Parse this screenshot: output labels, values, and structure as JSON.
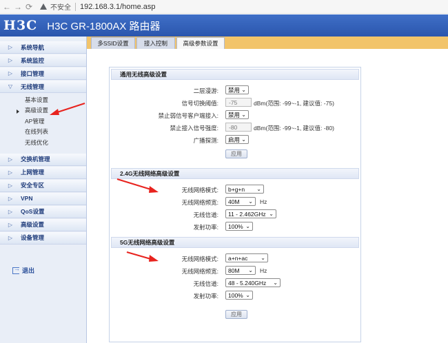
{
  "browser": {
    "insecure_label": "不安全",
    "url": "192.168.3.1/home.asp"
  },
  "header": {
    "logo": "H3C",
    "title": "H3C GR-1800AX 路由器"
  },
  "sidebar": {
    "items": [
      {
        "label": "系统导航",
        "arrow": "▷"
      },
      {
        "label": "系统监控",
        "arrow": "▷"
      },
      {
        "label": "接口管理",
        "arrow": "▷"
      },
      {
        "label": "无线管理",
        "arrow": "▽"
      }
    ],
    "sub_items": [
      {
        "label": "基本设置"
      },
      {
        "label": "高级设置"
      },
      {
        "label": "AP管理"
      },
      {
        "label": "在线列表"
      },
      {
        "label": "无线优化"
      }
    ],
    "items_after": [
      {
        "label": "交换机管理",
        "arrow": "▷"
      },
      {
        "label": "上网管理",
        "arrow": "▷"
      },
      {
        "label": "安全专区",
        "arrow": "▷"
      },
      {
        "label": "VPN",
        "arrow": "▷"
      },
      {
        "label": "QoS设置",
        "arrow": "▷"
      },
      {
        "label": "高级设置",
        "arrow": "▷"
      },
      {
        "label": "设备管理",
        "arrow": "▷"
      }
    ],
    "logout": "退出"
  },
  "tabs": [
    {
      "label": "多SSID设置"
    },
    {
      "label": "接入控制"
    },
    {
      "label": "高级参数设置"
    }
  ],
  "general": {
    "heading": "通用无线高级设置",
    "rows": [
      {
        "label": "二层漫游:",
        "value": "禁用"
      },
      {
        "label": "信号切换阈值:",
        "value": "-75",
        "hint": "dBm(范围: -99~-1, 建议值: -75)"
      },
      {
        "label": "禁止弱信号客户端接入:",
        "value": "禁用"
      },
      {
        "label": "禁止接入信号强度:",
        "value": "-80",
        "hint": "dBm(范围: -99~-1, 建议值: -80)"
      },
      {
        "label": "广播探测:",
        "value": "启用"
      }
    ],
    "apply": "应用"
  },
  "band24": {
    "heading": "2.4G无线网络高级设置",
    "rows": [
      {
        "label": "无线网络模式:",
        "value": "b+g+n"
      },
      {
        "label": "无线网络频宽:",
        "value": "40M",
        "unit": "Hz"
      },
      {
        "label": "无线信道:",
        "value": "11 - 2.462GHz"
      },
      {
        "label": "发射功率:",
        "value": "100%"
      }
    ]
  },
  "band5": {
    "heading": "5G无线网络高级设置",
    "rows": [
      {
        "label": "无线网络模式:",
        "value": "a+n+ac"
      },
      {
        "label": "无线网络频宽:",
        "value": "80M",
        "unit": "Hz"
      },
      {
        "label": "无线信道:",
        "value": "48 - 5.240GHz"
      },
      {
        "label": "发射功率:",
        "value": "100%"
      }
    ],
    "apply": "应用"
  },
  "colors": {
    "header": "#2f5cb3",
    "tabbar": "#f2c46a",
    "arrow": "#e8231e"
  }
}
